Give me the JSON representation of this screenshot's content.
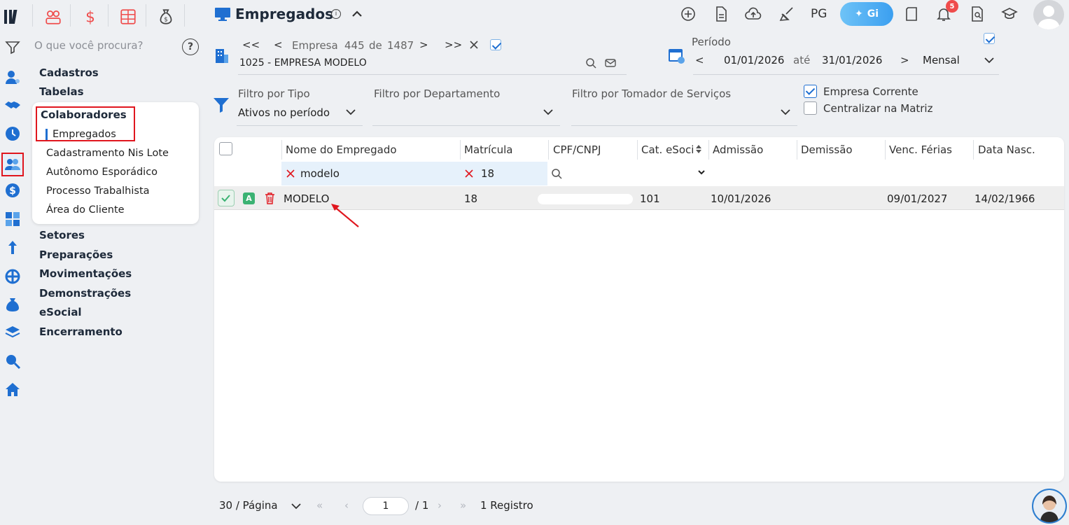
{
  "nav": {
    "search_placeholder": "O que você procura?",
    "sections": [
      "Cadastros",
      "Tabelas"
    ],
    "group_title": "Colaboradores",
    "group_items": [
      "Empregados",
      "Cadastramento Nis Lote",
      "Autônomo Esporádico",
      "Processo Trabalhista",
      "Área do Cliente"
    ],
    "sections_after": [
      "Setores",
      "Preparações",
      "Movimentações",
      "Demonstrações",
      "eSocial",
      "Encerramento"
    ]
  },
  "header": {
    "title": "Empregados",
    "pg_label": "PG",
    "gi_label": "Gi",
    "notification_count": "5"
  },
  "company": {
    "prev_all": "<<",
    "prev": "<",
    "next": ">",
    "next_all": ">>",
    "position_text": "Empresa",
    "current": "445",
    "of": "de",
    "total": "1487",
    "name": "1025 - EMPRESA MODELO"
  },
  "period": {
    "label": "Período",
    "start": "01/01/2026",
    "until": "até",
    "end": "31/01/2026",
    "mode": "Mensal"
  },
  "filters": {
    "type_label": "Filtro por Tipo",
    "type_value": "Ativos no período",
    "dept_label": "Filtro por Departamento",
    "tomador_label": "Filtro por Tomador de Serviços",
    "empresa_corrente": "Empresa Corrente",
    "centralizar": "Centralizar na Matriz"
  },
  "table": {
    "columns": [
      "Nome do Empregado",
      "Matrícula",
      "CPF/CNPJ",
      "Cat. eSocial",
      "Admissão",
      "Demissão",
      "Venc. Férias",
      "Data Nasc."
    ],
    "filter_name": "modelo",
    "filter_matricula": "18",
    "rows": [
      {
        "status": "A",
        "nome": "MODELO",
        "matricula": "18",
        "cat": "101",
        "admissao": "10/01/2026",
        "demissao": "",
        "venc_ferias": "09/01/2027",
        "nascimento": "14/02/1966"
      }
    ]
  },
  "pagination": {
    "per_page": "30 / Página",
    "page": "1",
    "of_pages": "/ 1",
    "records": "1 Registro"
  },
  "colors": {
    "accent": "#1f6fd1",
    "highlight": "#e0161e",
    "status_active": "#3bb273"
  }
}
